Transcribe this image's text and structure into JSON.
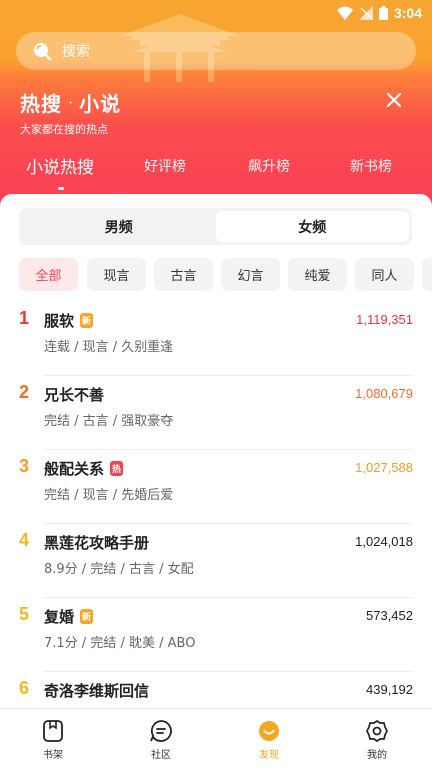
{
  "status_bar": {
    "time": "3:04"
  },
  "search": {
    "placeholder": "搜索"
  },
  "header": {
    "title_left": "热搜",
    "title_dot": "·",
    "title_right": "小说",
    "subtitle": "大家都在搜的热点"
  },
  "tabs": [
    {
      "label": "小说热搜",
      "active": true
    },
    {
      "label": "好评榜",
      "active": false
    },
    {
      "label": "飙升榜",
      "active": false
    },
    {
      "label": "新书榜",
      "active": false
    }
  ],
  "gender": {
    "male": "男频",
    "female": "女频",
    "selected": "女频"
  },
  "categories": [
    "全部",
    "现言",
    "古言",
    "幻言",
    "纯爱",
    "同人"
  ],
  "books": [
    {
      "rank": "1",
      "title": "服软",
      "badge": "新",
      "meta": "连载 / 现言 / 久别重逢",
      "heat": "1,119,351"
    },
    {
      "rank": "2",
      "title": "兄长不善",
      "badge": "",
      "meta": "完结 / 古言 / 强取豪夺",
      "heat": "1,080,679"
    },
    {
      "rank": "3",
      "title": "般配关系",
      "badge": "热",
      "meta": "完结 / 现言 / 先婚后爱",
      "heat": "1,027,588"
    },
    {
      "rank": "4",
      "title": "黑莲花攻略手册",
      "badge": "",
      "meta": "8.9分 / 完结 / 古言 / 女配",
      "heat": "1,024,018"
    },
    {
      "rank": "5",
      "title": "复婚",
      "badge": "新",
      "meta": "7.1分 / 完结 / 耽美 / ABO",
      "heat": "573,452"
    },
    {
      "rank": "6",
      "title": "奇洛李维斯回信",
      "badge": "",
      "meta": "",
      "heat": "439,192"
    }
  ],
  "bottom_nav": [
    {
      "label": "书架",
      "icon": "bookshelf-icon"
    },
    {
      "label": "社区",
      "icon": "community-icon"
    },
    {
      "label": "发现",
      "icon": "discover-icon",
      "active": true
    },
    {
      "label": "我的",
      "icon": "settings-gear-icon"
    }
  ],
  "colors": {
    "rank1": "#f2343e",
    "rank2": "#f86a23",
    "rank3": "#f59d1f",
    "rank_other": "#f5b91f",
    "badge_new": "#f5a623",
    "badge_hot": "#f2434e",
    "accent": "#f5a623"
  }
}
